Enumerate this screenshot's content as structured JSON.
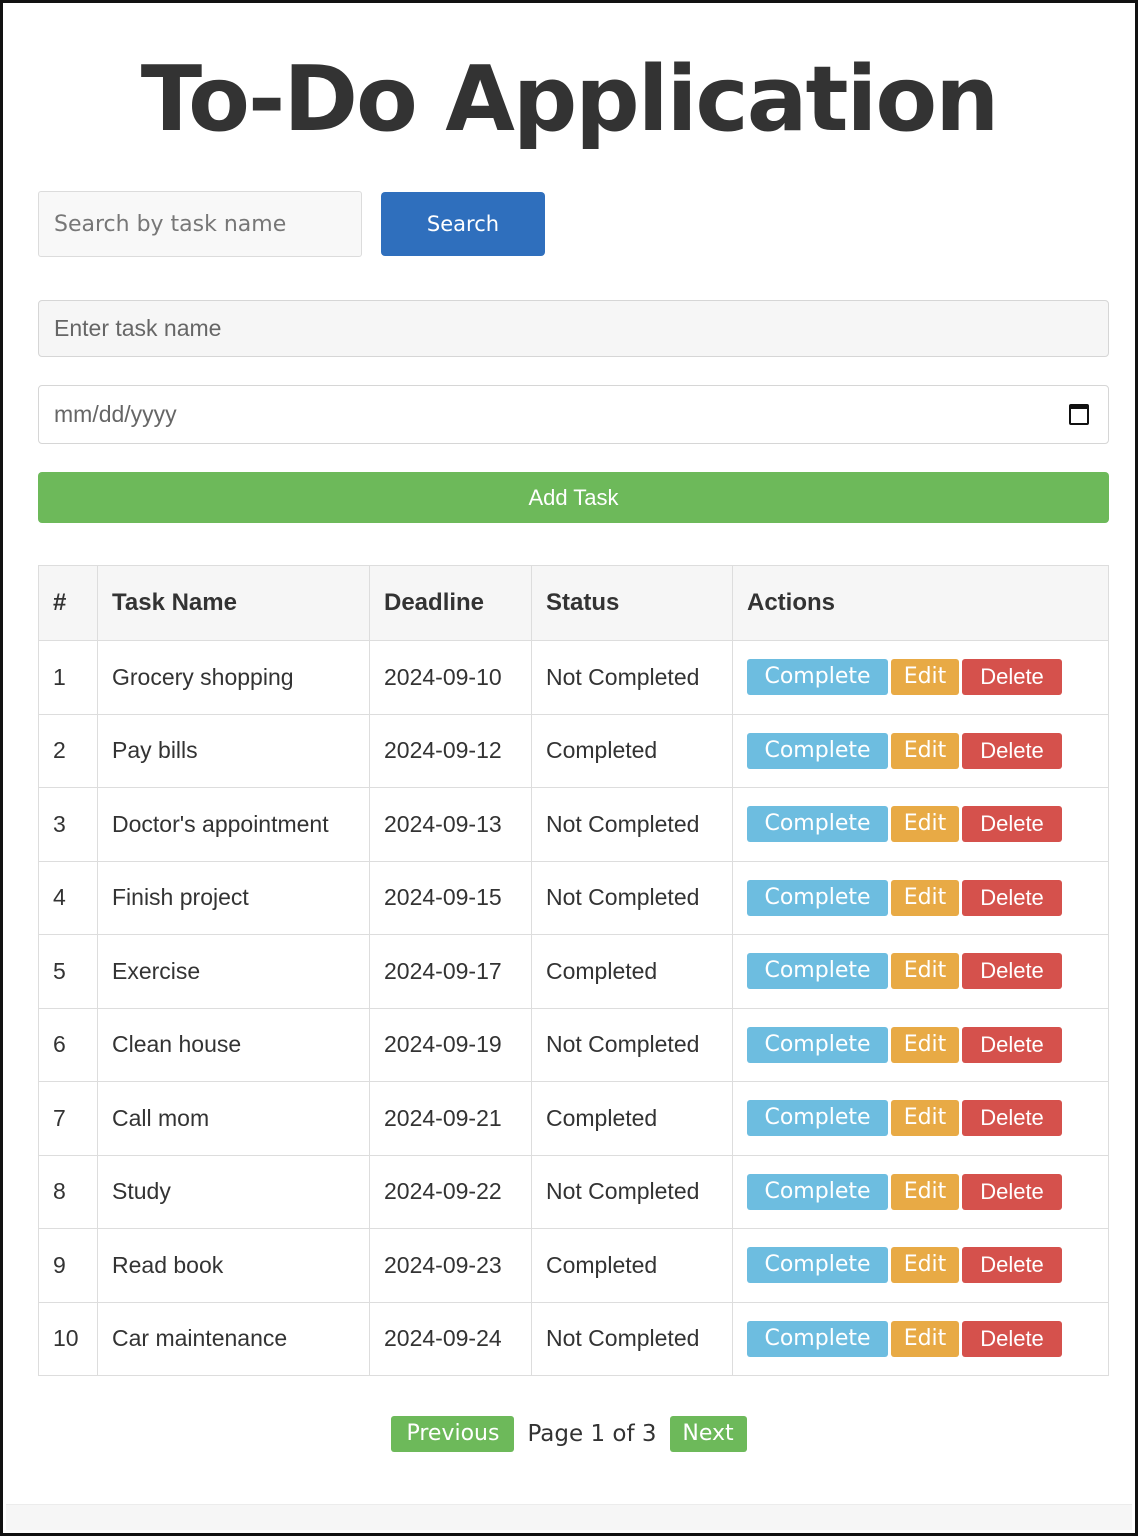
{
  "app": {
    "title": "To-Do Application"
  },
  "search": {
    "placeholder": "Search by task name",
    "value": "",
    "button_label": "Search"
  },
  "new_task": {
    "name_placeholder": "Enter task name",
    "date_placeholder": "mm/dd/yyyy",
    "date_icon": "calendar-icon",
    "add_label": "Add Task"
  },
  "table": {
    "headers": [
      "#",
      "Task Name",
      "Deadline",
      "Status",
      "Actions"
    ],
    "rows": [
      {
        "num": "1",
        "name": "Grocery shopping",
        "deadline": "2024-09-10",
        "status": "Not Completed"
      },
      {
        "num": "2",
        "name": "Pay bills",
        "deadline": "2024-09-12",
        "status": "Completed"
      },
      {
        "num": "3",
        "name": "Doctor's appointment",
        "deadline": "2024-09-13",
        "status": "Not Completed"
      },
      {
        "num": "4",
        "name": "Finish project",
        "deadline": "2024-09-15",
        "status": "Not Completed"
      },
      {
        "num": "5",
        "name": "Exercise",
        "deadline": "2024-09-17",
        "status": "Completed"
      },
      {
        "num": "6",
        "name": "Clean house",
        "deadline": "2024-09-19",
        "status": "Not Completed"
      },
      {
        "num": "7",
        "name": "Call mom",
        "deadline": "2024-09-21",
        "status": "Completed"
      },
      {
        "num": "8",
        "name": "Study",
        "deadline": "2024-09-22",
        "status": "Not Completed"
      },
      {
        "num": "9",
        "name": "Read book",
        "deadline": "2024-09-23",
        "status": "Completed"
      },
      {
        "num": "10",
        "name": "Car maintenance",
        "deadline": "2024-09-24",
        "status": "Not Completed"
      }
    ],
    "actions": {
      "complete": "Complete",
      "edit": "Edit",
      "delete": "Delete"
    }
  },
  "pagination": {
    "previous": "Previous",
    "info": "Page 1 of 3",
    "next": "Next"
  },
  "colors": {
    "primary": "#2f6fbd",
    "success": "#6db95a",
    "info": "#6dbde0",
    "warning": "#e8aa45",
    "danger": "#d5514c"
  }
}
